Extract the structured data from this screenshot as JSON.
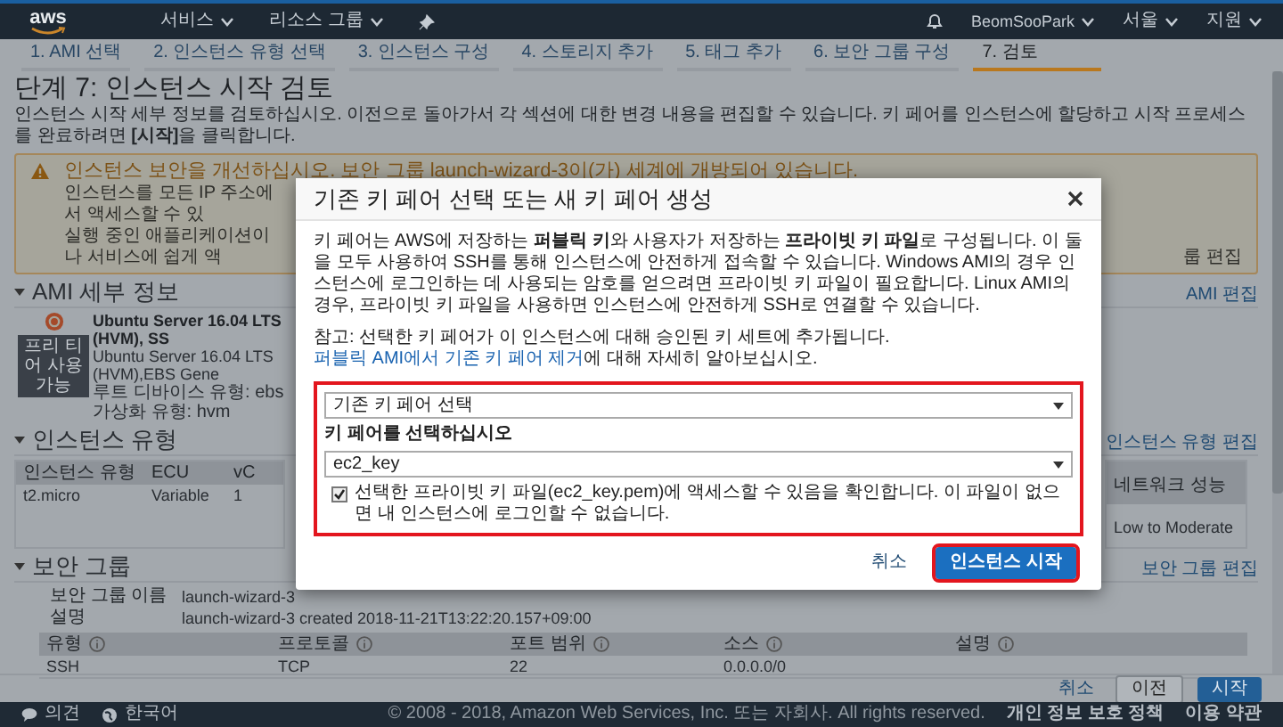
{
  "top_nav": {
    "logo": "aws",
    "menus": [
      "서비스",
      "리소스 그룹"
    ],
    "user": "BeomSooPark",
    "region": "서울",
    "support": "지원"
  },
  "steps": [
    {
      "label": "1. AMI 선택",
      "selected": false
    },
    {
      "label": "2. 인스턴스 유형 선택",
      "selected": false
    },
    {
      "label": "3. 인스턴스 구성",
      "selected": false
    },
    {
      "label": "4. 스토리지 추가",
      "selected": false
    },
    {
      "label": "5. 태그 추가",
      "selected": false
    },
    {
      "label": "6. 보안 그룹 구성",
      "selected": false
    },
    {
      "label": "7. 검토",
      "selected": true
    }
  ],
  "page": {
    "title": "단계 7: 인스턴스 시작 검토",
    "subtitle": "인스턴스 시작 세부 정보를 검토하십시오. 이전으로 돌아가서 각 섹션에 대한 변경 내용을 편집할 수 있습니다. 키 페어를 인스턴스에 할당하고 시작 프로세스를 완료하려면 **[시작]**을 클릭합니다."
  },
  "warning": {
    "title": "인스턴스 보안을 개선하십시오. 보안 그룹 launch-wizard-3이(가) 세계에 개방되어 있습니다.",
    "lines": [
      "인스턴스를 모든 IP 주소에서 액세스할 수 있",
      "실행 중인 애플리케이션이나 서비스에 쉽게 액"
    ],
    "action": "룹 편집"
  },
  "ami": {
    "heading": "AMI 세부 정보",
    "edit": "AMI 편집",
    "badge": "프리 티어 사용 가능",
    "name": "Ubuntu Server 16.04 LTS (HVM), SS",
    "description": "Ubuntu Server 16.04 LTS (HVM),EBS Gene",
    "meta": [
      "루트 디바이스 유형: ebs",
      "가상화 유형: hvm"
    ]
  },
  "instance_type": {
    "heading": "인스턴스 유형",
    "edit": "인스턴스 유형 편집",
    "columns": [
      "인스턴스 유형",
      "ECU",
      "vC",
      "네트워크 성능"
    ],
    "rows": [
      [
        "t2.micro",
        "Variable",
        "1",
        "Low to Moderate"
      ]
    ]
  },
  "security_group": {
    "heading": "보안 그룹",
    "edit": "보안 그룹 편집",
    "fields": [
      {
        "label": "보안 그룹 이름",
        "value": "launch-wizard-3"
      },
      {
        "label": "설명",
        "value": "launch-wizard-3 created 2018-11-21T13:22:20.157+09:00"
      }
    ],
    "rules": {
      "columns": [
        "유형",
        "프로토콜",
        "포트 범위",
        "소스",
        "설명"
      ],
      "rows": [
        [
          "SSH",
          "TCP",
          "22",
          "0.0.0.0/0"
        ]
      ]
    }
  },
  "actions": [
    {
      "label": "취소",
      "kind": "link"
    },
    {
      "label": "이전",
      "kind": "secondary"
    },
    {
      "label": "시작",
      "kind": "primary"
    }
  ],
  "footer": {
    "feedback": "의견",
    "language": "한국어",
    "copyright": "© 2008 - 2018, Amazon Web Services, Inc. 또는 자회사. All rights reserved.",
    "links": [
      "개인 정보 보호 정책",
      "이용 약관"
    ]
  },
  "dialog": {
    "title": "기존 키 페어 선택 또는 새 키 페어 생성",
    "intro": "키 페어는 AWS에 저장하는 **퍼블릭 키**와 사용자가 저장하는 **프라이빗 키 파일**로 구성됩니다. 이 둘을 모두 사용하여 SSH를 통해 인스턴스에 안전하게 접속할 수 있습니다. Windows AMI의 경우 인스턴스에 로그인하는 데 사용되는 암호를 얻으려면 프라이빗 키 파일이 필요합니다. Linux AMI의 경우, 프라이빗 키 파일을 사용하면 인스턴스에 안전하게 SSH로 연결할 수 있습니다.",
    "note": "참고: 선택한 키 페어가 이 인스턴스에 대해 승인된 키 세트에 추가됩니다. ",
    "note_link": "퍼블릭 AMI에서 기존 키 페어 제거",
    "note_after": "에 대해 자세히 알아보십시오.",
    "mode_select": "기존 키 페어 선택",
    "key_label": "키 페어를 선택하십시오",
    "key_select": "ec2_key",
    "acknowledge": {
      "text": "선택한 프라이빗 키 파일(ec2_key.pem)에 액세스할 수 있음을 확인합니다. 이 파일이 없으면 내 인스턴스에 로그인할 수 없습니다.",
      "checked": true
    },
    "buttons": [
      {
        "label": "취소",
        "kind": "link"
      },
      {
        "label": "인스턴스 시작",
        "kind": "primary"
      }
    ]
  }
}
